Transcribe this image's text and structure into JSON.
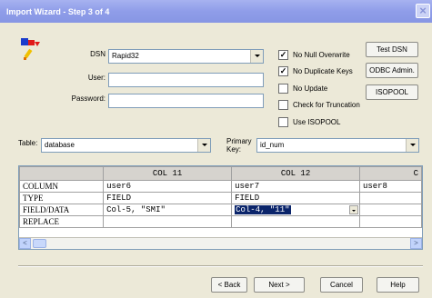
{
  "window": {
    "title": "Import Wizard - Step 3 of 4",
    "close_label": "×"
  },
  "icons": {
    "app": "import-wizard-icon"
  },
  "connection": {
    "dsn_label": "DSN",
    "dsn_value": "Rapid32",
    "user_label": "User:",
    "user_value": "",
    "password_label": "Password:",
    "password_value": ""
  },
  "options": [
    {
      "label": "No Null Overwrite",
      "checked": true,
      "mark": "✓"
    },
    {
      "label": "No Duplicate Keys",
      "checked": true,
      "mark": "✓"
    },
    {
      "label": "No Update",
      "checked": false,
      "mark": ""
    },
    {
      "label": "Check for Truncation",
      "checked": false,
      "mark": ""
    },
    {
      "label": "Use ISOPOOL",
      "checked": false,
      "mark": ""
    }
  ],
  "side_buttons": {
    "test_dsn": "Test DSN",
    "odbc_admin": "ODBC Admin.",
    "isopool": "ISOPOOL"
  },
  "table_select": {
    "label": "Table:",
    "value": "database"
  },
  "primary_key": {
    "label_line1": "Primary",
    "label_line2": "Key:",
    "value": "id_num"
  },
  "grid": {
    "columns": [
      "COL 11",
      "COL 12",
      "C"
    ],
    "rows": [
      {
        "header": "COLUMN",
        "cells": [
          "user6",
          "user7",
          "user8"
        ]
      },
      {
        "header": "TYPE",
        "cells": [
          "FIELD",
          "FIELD",
          ""
        ]
      },
      {
        "header": "FIELD/DATA",
        "cells": [
          "Col-5, \"SMI\"",
          "Col-4, \"11\"",
          ""
        ]
      },
      {
        "header": "REPLACE",
        "cells": [
          "",
          "",
          ""
        ]
      }
    ],
    "scroll_left": "<",
    "scroll_right": ">"
  },
  "footer": {
    "back": "< Back",
    "next": "Next >",
    "cancel": "Cancel",
    "help": "Help"
  },
  "colors": {
    "title_bar": "#8f9de9",
    "selection": "#0a246a",
    "dialog_bg": "#ece9d8"
  }
}
